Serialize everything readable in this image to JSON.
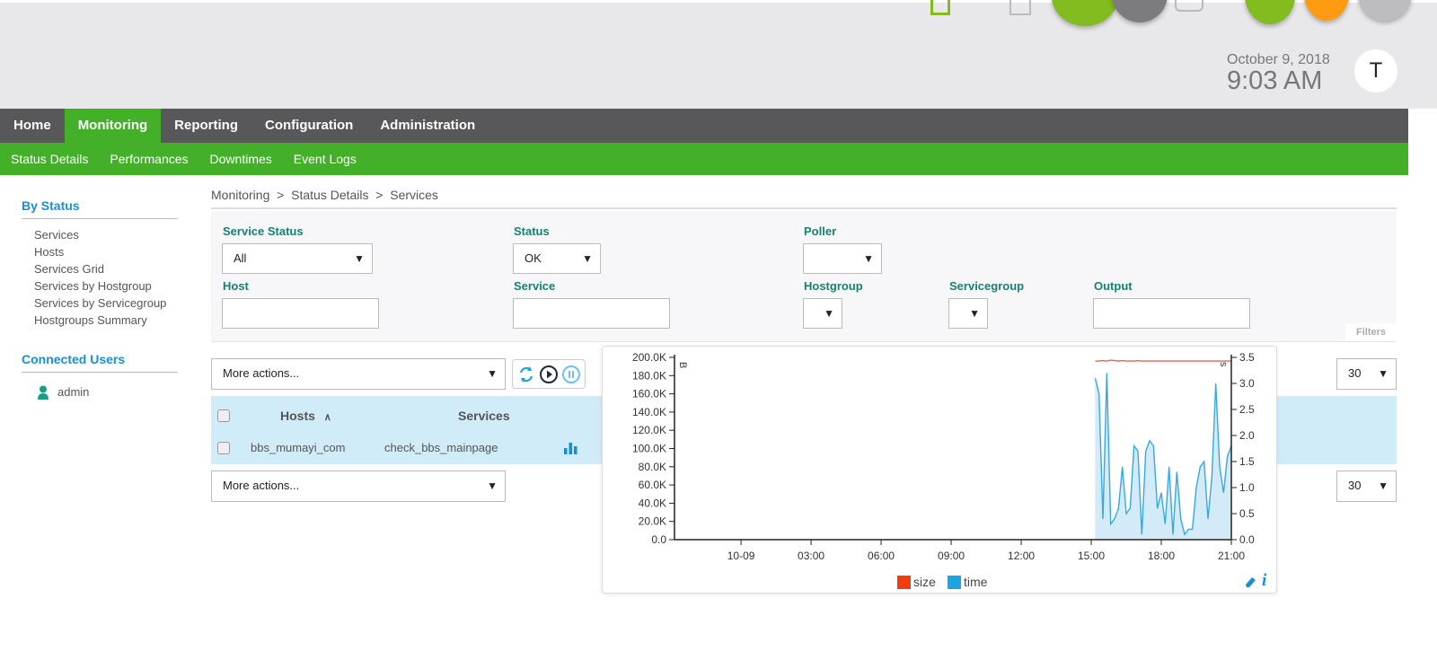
{
  "header": {
    "date": "October 9, 2018",
    "time": "9:03 AM",
    "user_initial": "T",
    "status_indicators": [
      {
        "color": "#82bc1e"
      },
      {
        "color": "#7c7c80"
      },
      {
        "color": "#82bc1e"
      },
      {
        "color": "#ff9a13"
      },
      {
        "color": "#bdbdc1"
      }
    ]
  },
  "nav": {
    "items": [
      "Home",
      "Monitoring",
      "Reporting",
      "Configuration",
      "Administration"
    ],
    "active": "Monitoring"
  },
  "subnav": {
    "items": [
      "Status Details",
      "Performances",
      "Downtimes",
      "Event Logs"
    ]
  },
  "sidebar": {
    "by_status_title": "By Status",
    "items": [
      "Services",
      "Hosts",
      "Services Grid",
      "Services by Hostgroup",
      "Services by Servicegroup",
      "Hostgroups Summary"
    ],
    "connected_title": "Connected Users",
    "users": [
      "admin"
    ]
  },
  "breadcrumb": [
    "Monitoring",
    ">",
    "Status Details",
    ">",
    "Services"
  ],
  "filters": {
    "service_status_label": "Service Status",
    "service_status_value": "All",
    "status_label": "Status",
    "status_value": "OK",
    "poller_label": "Poller",
    "poller_value": "",
    "host_label": "Host",
    "host_value": "",
    "service_label": "Service",
    "service_value": "",
    "hostgroup_label": "Hostgroup",
    "servicegroup_label": "Servicegroup",
    "output_label": "Output",
    "output_value": "",
    "filters_tab": "Filters"
  },
  "actions": {
    "more_actions": "More actions...",
    "page_size": "30"
  },
  "table": {
    "columns": [
      "Hosts",
      "Services"
    ],
    "rows": [
      {
        "host": "bbs_mumayi_com",
        "service": "check_bbs_mainpage"
      }
    ]
  },
  "chart_data": {
    "type": "line",
    "x_tick_labels": [
      "10-09",
      "03:00",
      "06:00",
      "09:00",
      "12:00",
      "15:00",
      "18:00",
      "21:00"
    ],
    "xlim": [
      "10-08 21:09",
      "10-09 21:00"
    ],
    "y_left": {
      "unit": "B",
      "ylim": [
        0,
        200000
      ],
      "tick_labels": [
        "0.0",
        "20.0K",
        "40.0K",
        "60.0K",
        "80.0K",
        "100.0K",
        "120.0K",
        "140.0K",
        "160.0K",
        "180.0K",
        "200.0K"
      ]
    },
    "y_right": {
      "unit": "s",
      "ylim": [
        0,
        3.5
      ],
      "tick_labels": [
        "0.0",
        "0.5",
        "1.0",
        "1.5",
        "2.0",
        "2.5",
        "3.0",
        "3.5"
      ]
    },
    "x": [
      "15:10",
      "15:20",
      "15:30",
      "15:40",
      "15:50",
      "16:00",
      "16:10",
      "16:20",
      "16:30",
      "16:40",
      "16:50",
      "17:00",
      "17:10",
      "17:20",
      "17:30",
      "17:40",
      "17:50",
      "18:00",
      "18:10",
      "18:20",
      "18:30",
      "18:40",
      "18:50",
      "19:00",
      "19:10",
      "19:20",
      "19:30",
      "19:40",
      "19:50",
      "20:00",
      "20:10",
      "20:20",
      "20:30",
      "20:40",
      "20:50",
      "21:00"
    ],
    "series": [
      {
        "name": "size",
        "color": "#f03c10",
        "axis": "left",
        "values": [
          196000,
          196000,
          196500,
          196000,
          197000,
          196500,
          196000,
          196500,
          196000,
          196000,
          196000,
          196500,
          196000,
          196000,
          196000,
          196000,
          196000,
          196000,
          196000,
          196000,
          196000,
          196000,
          196000,
          196000,
          196000,
          196000,
          196000,
          196000,
          196000,
          196000,
          196000,
          196000,
          196000,
          196000,
          196000,
          196000
        ]
      },
      {
        "name": "time",
        "color": "#1ea5e0",
        "axis": "right",
        "area": true,
        "values": [
          3.1,
          2.8,
          0.4,
          3.2,
          0.3,
          0.4,
          0.6,
          1.4,
          0.5,
          0.6,
          1.8,
          1.7,
          0.1,
          1.7,
          1.9,
          1.8,
          0.6,
          0.9,
          0.3,
          1.4,
          0.1,
          1.3,
          0.4,
          0.1,
          0.2,
          0.2,
          1.0,
          1.4,
          1.5,
          0.4,
          1.2,
          3.0,
          1.4,
          0.9,
          1.6,
          1.8
        ]
      }
    ],
    "legend": "bottom-center"
  }
}
